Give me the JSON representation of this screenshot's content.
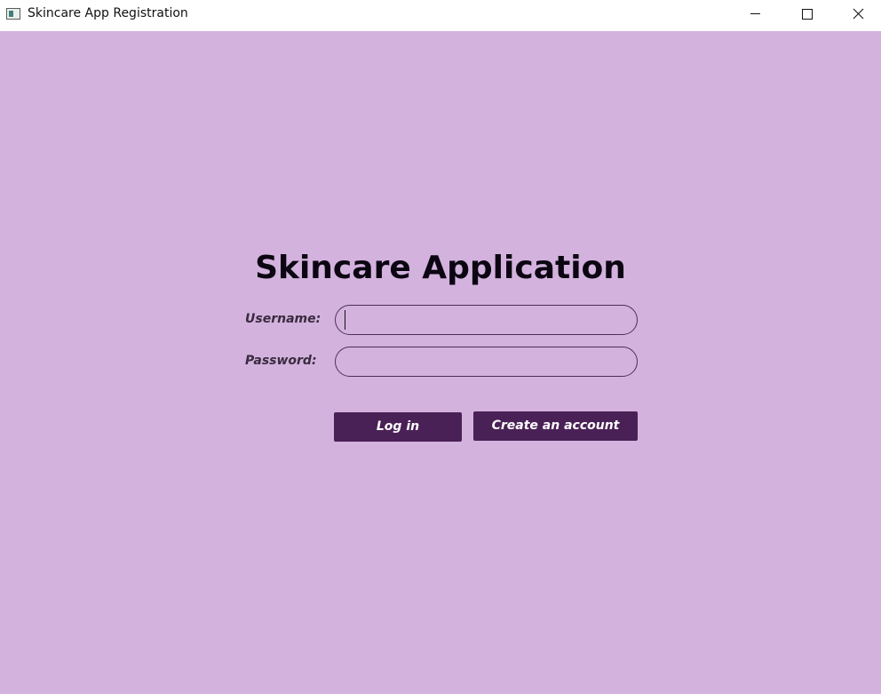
{
  "window": {
    "title": "Skincare App Registration",
    "controls": {
      "minimize": "minimize-icon",
      "maximize": "maximize-icon",
      "close": "close-icon"
    }
  },
  "form": {
    "heading": "Skincare Application",
    "username": {
      "label": "Username:",
      "value": "",
      "placeholder": ""
    },
    "password": {
      "label": "Password:",
      "value": "",
      "placeholder": ""
    },
    "login_label": "Log in",
    "create_account_label": "Create an account"
  },
  "colors": {
    "background": "#d3b3de",
    "button": "#4a2156",
    "button_text": "#ffffff",
    "field_border": "#4e2f59",
    "heading": "#0c0612",
    "label": "#3a2a3f"
  }
}
